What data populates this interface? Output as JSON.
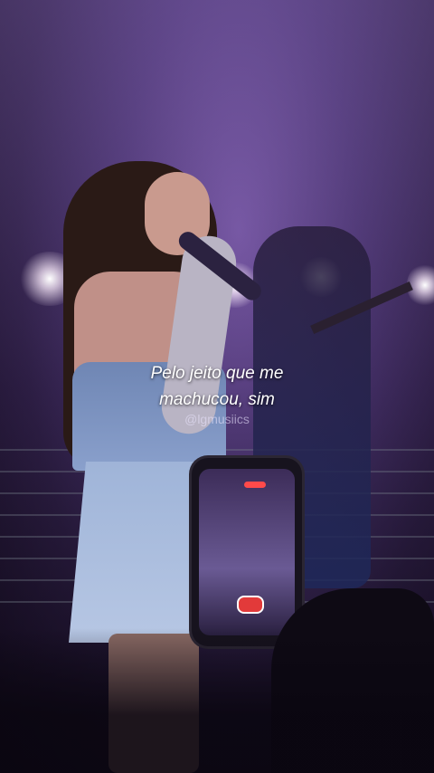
{
  "lyrics": {
    "line1": "Pelo jeito que me",
    "line2": "machucou, sim"
  },
  "watermark": "@lgmusiics",
  "colors": {
    "stage_light": "#7a5aa8",
    "text": "#ffffff",
    "record_red": "#e23a3a"
  }
}
